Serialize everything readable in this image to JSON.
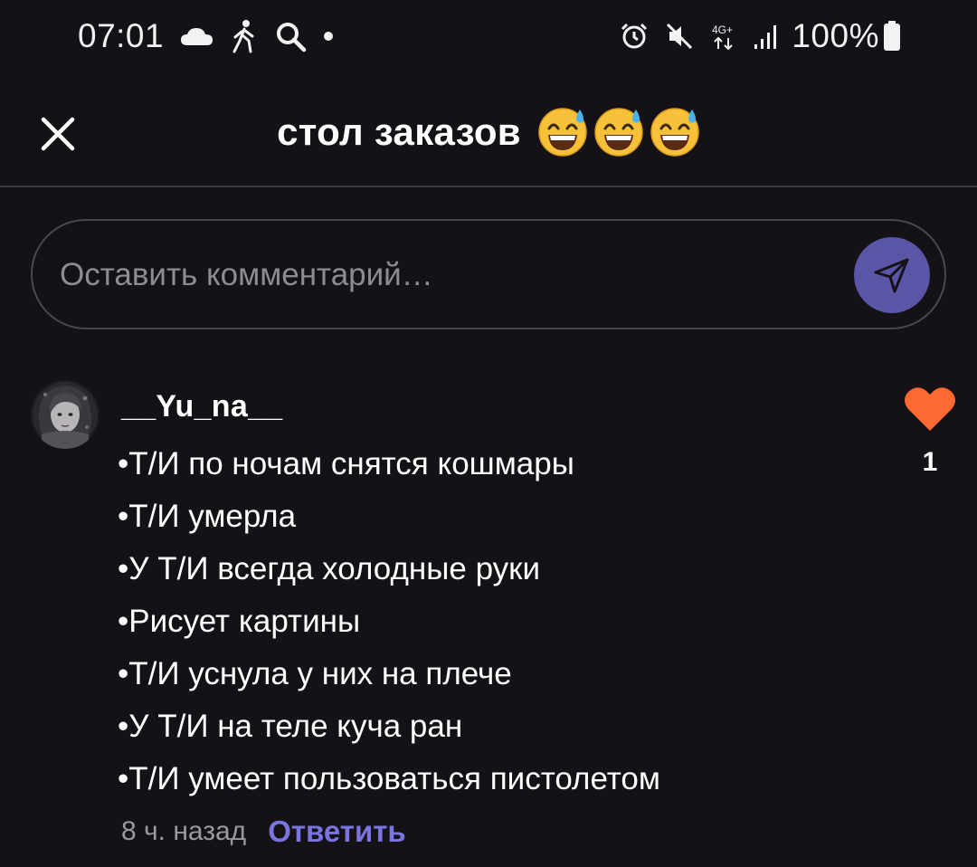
{
  "status_bar": {
    "time": "07:01",
    "network": "4G+",
    "battery": "100%"
  },
  "header": {
    "title": "стол заказов",
    "close_icon": "close-icon",
    "emoji": "grinning-face-with-sweat"
  },
  "comment_input": {
    "placeholder": "Оставить комментарий…",
    "send_icon": "send-icon",
    "send_color": "#5a55a6"
  },
  "comment": {
    "username": "__Yu_na__",
    "lines": [
      "•Т/И по ночам снятся кошмары",
      "•Т/И умерла",
      "•У Т/И всегда холодные руки",
      "•Рисует картины",
      "•Т/И уснула у них на плече",
      "•У Т/И на теле куча ран",
      "•Т/И умеет пользоваться пистолетом"
    ],
    "timestamp": "8 ч. назад",
    "reply_label": "Ответить",
    "like_count": "1",
    "heart_color": "#ff6a33",
    "reply_color": "#7a74e0"
  },
  "colors": {
    "background": "#141216",
    "accent": "#5a55a6"
  }
}
